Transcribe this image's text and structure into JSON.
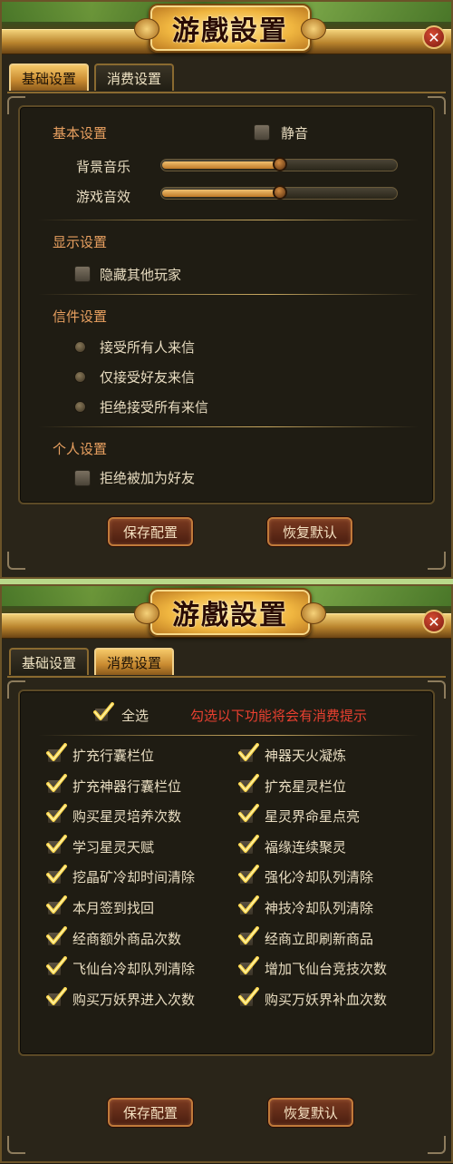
{
  "title": "游戲設置",
  "close_icon": "close-icon",
  "tabs": [
    {
      "label": "基础设置"
    },
    {
      "label": "消费设置"
    }
  ],
  "basic": {
    "section_basic": "基本设置",
    "mute_label": "静音",
    "mute_checked": false,
    "music_label": "背景音乐",
    "music_level": 0.5,
    "sfx_label": "游戏音效",
    "sfx_level": 0.5,
    "section_display": "显示设置",
    "hide_players_label": "隐藏其他玩家",
    "hide_players_checked": false,
    "section_mail": "信件设置",
    "mail_options": [
      {
        "label": "接受所有人来信"
      },
      {
        "label": "仅接受好友来信"
      },
      {
        "label": "拒绝接受所有来信"
      }
    ],
    "section_personal": "个人设置",
    "refuse_friend_label": "拒绝被加为好友",
    "refuse_friend_checked": false,
    "save_label": "保存配置",
    "reset_label": "恢复默认"
  },
  "spend": {
    "select_all_label": "全选",
    "select_all_checked": true,
    "notice": "勾选以下功能将会有消费提示",
    "left_items": [
      {
        "label": "扩充行囊栏位",
        "checked": true
      },
      {
        "label": "扩充神器行囊栏位",
        "checked": true
      },
      {
        "label": "购买星灵培养次数",
        "checked": true
      },
      {
        "label": "学习星灵天赋",
        "checked": true
      },
      {
        "label": "挖晶矿冷却时间清除",
        "checked": true
      },
      {
        "label": "本月签到找回",
        "checked": true
      },
      {
        "label": "经商额外商品次数",
        "checked": true
      },
      {
        "label": "飞仙台冷却队列清除",
        "checked": true
      },
      {
        "label": "购买万妖界进入次数",
        "checked": true
      }
    ],
    "right_items": [
      {
        "label": "神器天火凝炼",
        "checked": true
      },
      {
        "label": "扩充星灵栏位",
        "checked": true
      },
      {
        "label": "星灵界命星点亮",
        "checked": true
      },
      {
        "label": "福缘连续聚灵",
        "checked": true
      },
      {
        "label": "强化冷却队列清除",
        "checked": true
      },
      {
        "label": "神技冷却队列清除",
        "checked": true
      },
      {
        "label": "经商立即刷新商品",
        "checked": true
      },
      {
        "label": "增加飞仙台竞技次数",
        "checked": true
      },
      {
        "label": "购买万妖界补血次数",
        "checked": true
      }
    ],
    "save_label": "保存配置",
    "reset_label": "恢复默认"
  },
  "colors": {
    "accent_gold": "#f0c070",
    "warning_red": "#e84030",
    "section_orange": "#e8a060"
  }
}
